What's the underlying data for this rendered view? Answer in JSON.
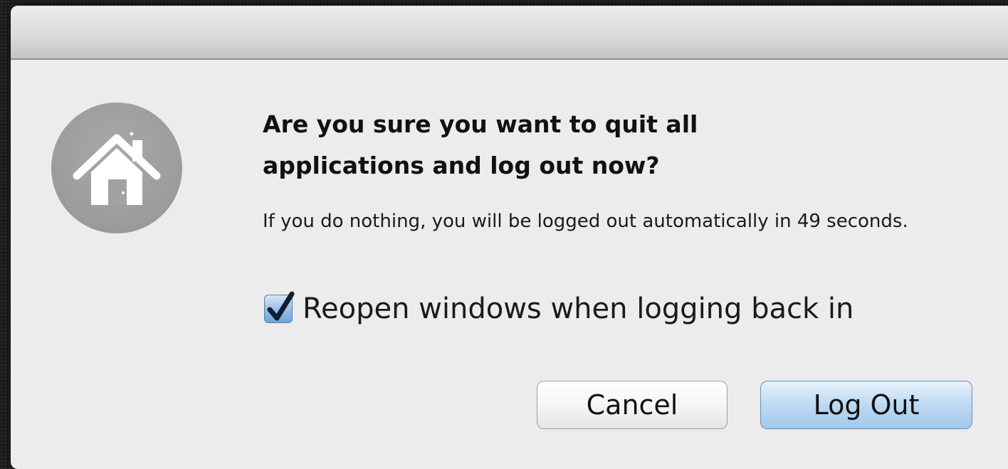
{
  "dialog": {
    "icon": "home-icon",
    "heading": "Are you sure you want to quit all applications and log out now?",
    "message": "If you do nothing, you will be logged out automatically in 49 seconds.",
    "checkbox": {
      "label": "Reopen windows when logging back in",
      "checked": true
    },
    "buttons": {
      "cancel": "Cancel",
      "log_out": "Log Out"
    }
  },
  "colors": {
    "dialog_background": "#ececec",
    "icon_circle": "#9b9b9b",
    "default_button": "#bcd9f2",
    "checkbox_accent": "#6fa4db"
  }
}
